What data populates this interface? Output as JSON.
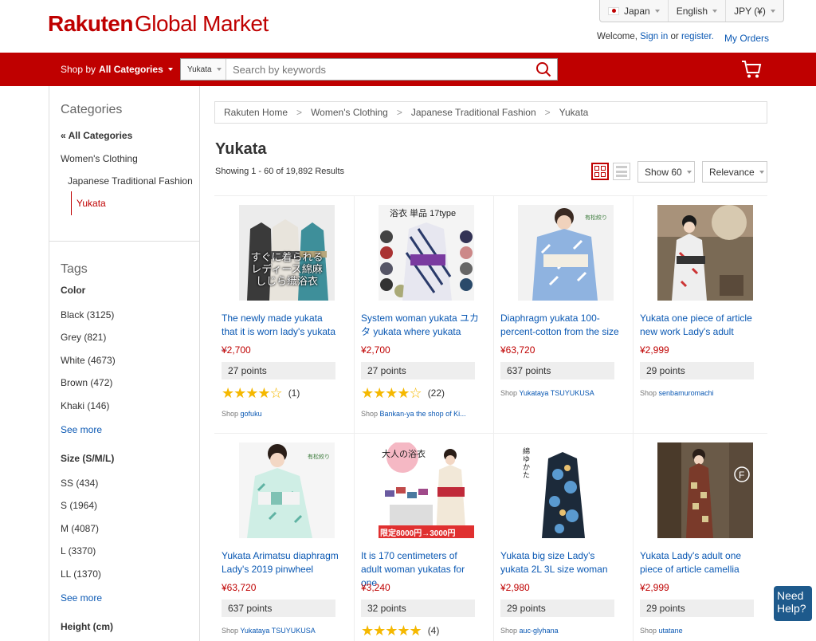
{
  "header": {
    "logo_brand": "Rakuten",
    "logo_rest": "Global Market",
    "country": "Japan",
    "language": "English",
    "currency": "JPY (¥)",
    "welcome_prefix": "Welcome,",
    "sign_in": "Sign in",
    "or": "or",
    "register": "register.",
    "my_orders": "My Orders"
  },
  "nav": {
    "shop_by": "Shop by",
    "all_categories": "All Categories",
    "search_category": "Yukata",
    "search_placeholder": "Search by keywords"
  },
  "sidebar": {
    "categories_title": "Categories",
    "all_categories": "« All Categories",
    "womens": "Women's Clothing",
    "jtf": "Japanese Traditional Fashion",
    "yukata": "Yukata",
    "tags_title": "Tags",
    "color_title": "Color",
    "colors": [
      "Black (3125)",
      "Grey (821)",
      "White (4673)",
      "Brown (472)",
      "Khaki (146)"
    ],
    "see_more": "See more",
    "size_title": "Size (S/M/L)",
    "sizes": [
      "SS (434)",
      "S (1964)",
      "M (4087)",
      "L (3370)",
      "LL (1370)"
    ],
    "height_title": "Height (cm)"
  },
  "main": {
    "breadcrumb": [
      "Rakuten Home",
      "Women's Clothing",
      "Japanese Traditional Fashion",
      "Yukata"
    ],
    "breadcrumb_sep": ">",
    "title": "Yukata",
    "showing": "Showing 1 - 60 of 19,892 Results",
    "show_label": "Show 60",
    "sort_label": "Relevance"
  },
  "products": [
    {
      "title": "The newly made yukata that it is worn lady's yukata _",
      "price": "¥2,700",
      "points": "27 points",
      "stars": 4,
      "rating_count": "(1)",
      "shop_prefix": "Shop",
      "shop": "gofuku",
      "img_text": "すぐに着られる\nレディース綿麻\nしじら織浴衣"
    },
    {
      "title": "System woman yukata ユカタ yukata where yukata",
      "price": "¥2,700",
      "points": "27 points",
      "stars": 4,
      "rating_count": "(22)",
      "shop_prefix": "Shop",
      "shop": "Bankan-ya the shop of Ki...",
      "img_text": "浴衣 単品 17type"
    },
    {
      "title": "Diaphragm yukata 100-percent-cotton from the size",
      "price": "¥63,720",
      "points": "637 points",
      "stars": 0,
      "rating_count": "",
      "shop_prefix": "Shop",
      "shop": "Yukataya TSUYUKUSA",
      "img_text": "有松絞り"
    },
    {
      "title": "Yukata one piece of article new work Lady's adult",
      "price": "¥2,999",
      "points": "29 points",
      "stars": 0,
      "rating_count": "",
      "shop_prefix": "Shop",
      "shop": "senbamuromachi",
      "img_text": ""
    },
    {
      "title": "Yukata Arimatsu diaphragm Lady's 2019 pinwheel",
      "price": "¥63,720",
      "points": "637 points",
      "stars": 0,
      "rating_count": "",
      "shop_prefix": "Shop",
      "shop": "Yukataya TSUYUKUSA",
      "img_text": "有松絞り"
    },
    {
      "title": "It is 170 centimeters of adult woman yukatas for one",
      "price": "¥3,240",
      "points": "32 points",
      "stars": 4.5,
      "rating_count": "(4)",
      "shop_prefix": "Shop",
      "shop": "",
      "img_text": "大人の浴衣"
    },
    {
      "title": "Yukata big size Lady's yukata 2L 3L size woman",
      "price": "¥2,980",
      "points": "29 points",
      "stars": 0,
      "rating_count": "",
      "shop_prefix": "Shop",
      "shop": "auc-glyhana",
      "img_text": "綿ゆかた"
    },
    {
      "title": "Yukata Lady's adult one piece of article camellia",
      "price": "¥2,999",
      "points": "29 points",
      "stars": 0,
      "rating_count": "",
      "shop_prefix": "Shop",
      "shop": "utatane",
      "img_text": ""
    }
  ],
  "promo_badge": "限定8000円→3000円",
  "need_help": "Need Help?",
  "colors": {
    "brand_red": "#bf0000",
    "link_blue": "#0a58b3"
  }
}
